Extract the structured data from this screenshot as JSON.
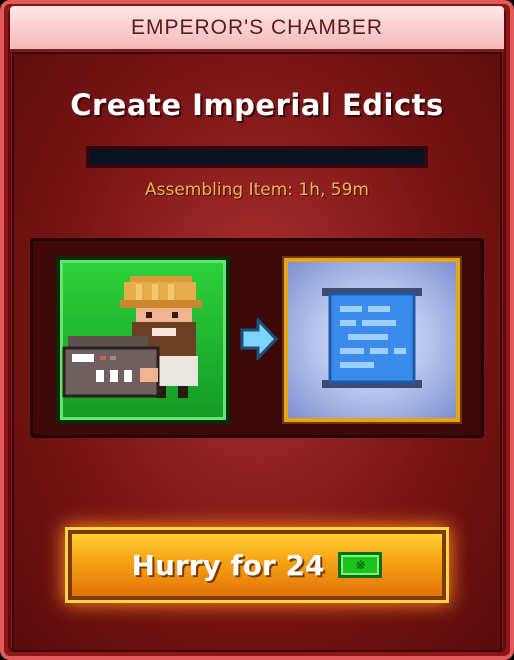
{
  "window": {
    "title": "EMPEROR'S CHAMBER"
  },
  "task": {
    "heading": "Create Imperial Edicts",
    "status": "Assembling Item: 1h, 59m",
    "progress": 0.0
  },
  "slots": {
    "input_icon": "bitizen-with-typewriter-icon",
    "arrow_icon": "arrow-right-icon",
    "output_icon": "scroll-document-icon"
  },
  "hurry": {
    "label": "Hurry for 24",
    "currency_icon": "bux-icon"
  },
  "colors": {
    "frame": "#8b1717",
    "title_bar": "#f4b9b9",
    "status_text": "#e9b64f",
    "input_slot": "#1fbb2d",
    "output_slot_border": "#e8a31c",
    "button": "#f7a616",
    "bux": "#1cc31c"
  }
}
